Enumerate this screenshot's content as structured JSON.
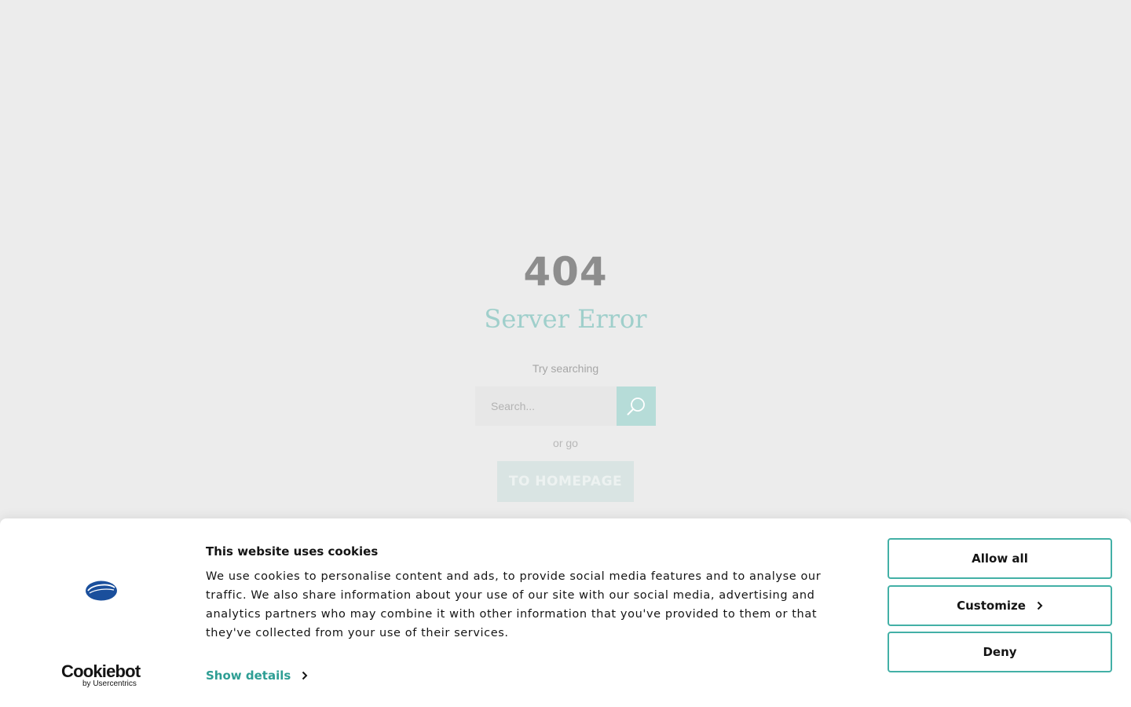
{
  "error_page": {
    "code": "404",
    "title": "Server Error",
    "try_text": "Try searching",
    "search_placeholder": "Search...",
    "or_text": "or go",
    "home_button": "TO HOMEPAGE"
  },
  "cookie_banner": {
    "title": "This website uses cookies",
    "text": "We use cookies to personalise content and ads, to provide social media features and to analyse our traffic. We also share information about your use of our site with our social media, advertising and analytics partners who may combine it with other information that you've provided to them or that they've collected from your use of their services.",
    "show_details": "Show details",
    "buttons": {
      "allow_all": "Allow all",
      "customize": "Customize",
      "deny": "Deny"
    },
    "cookiebot_logo": {
      "name": "Cookiebot",
      "tagline": "by Usercentrics"
    }
  },
  "colors": {
    "accent_teal": "#43b0a6",
    "link_teal": "#2e9e94",
    "brand_blue": "#1a4f9c",
    "error_title": "#9fcfcb"
  },
  "icons": {
    "search": "search-icon",
    "chevron": "chevron-right-icon",
    "brand": "brand-logo-icon"
  }
}
